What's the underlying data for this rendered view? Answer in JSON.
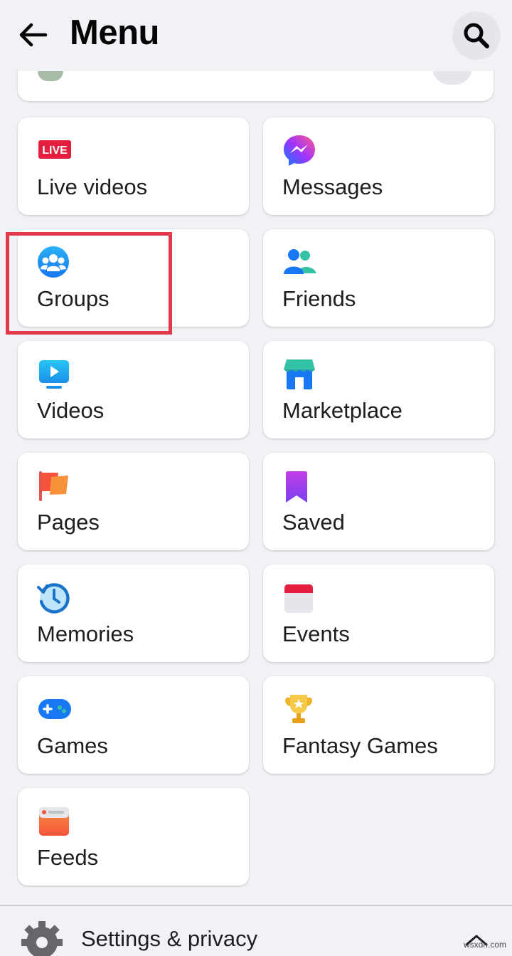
{
  "header": {
    "title": "Menu"
  },
  "shortcuts": [
    {
      "label": "Live videos",
      "icon": "live-icon",
      "badge": "LIVE"
    },
    {
      "label": "Messages",
      "icon": "messenger-icon"
    },
    {
      "label": "Groups",
      "icon": "groups-icon"
    },
    {
      "label": "Friends",
      "icon": "friends-icon"
    },
    {
      "label": "Videos",
      "icon": "video-icon"
    },
    {
      "label": "Marketplace",
      "icon": "marketplace-icon"
    },
    {
      "label": "Pages",
      "icon": "flag-icon"
    },
    {
      "label": "Saved",
      "icon": "bookmark-icon"
    },
    {
      "label": "Memories",
      "icon": "memories-clock-icon"
    },
    {
      "label": "Events",
      "icon": "calendar-icon"
    },
    {
      "label": "Games",
      "icon": "gamepad-icon"
    },
    {
      "label": "Fantasy Games",
      "icon": "trophy-icon"
    },
    {
      "label": "Feeds",
      "icon": "feeds-icon"
    }
  ],
  "settings": {
    "label": "Settings & privacy"
  },
  "watermark": "wsxdn.com",
  "colors": {
    "highlight": "#e23a4b",
    "background": "#f0f2f5",
    "card": "#ffffff"
  }
}
